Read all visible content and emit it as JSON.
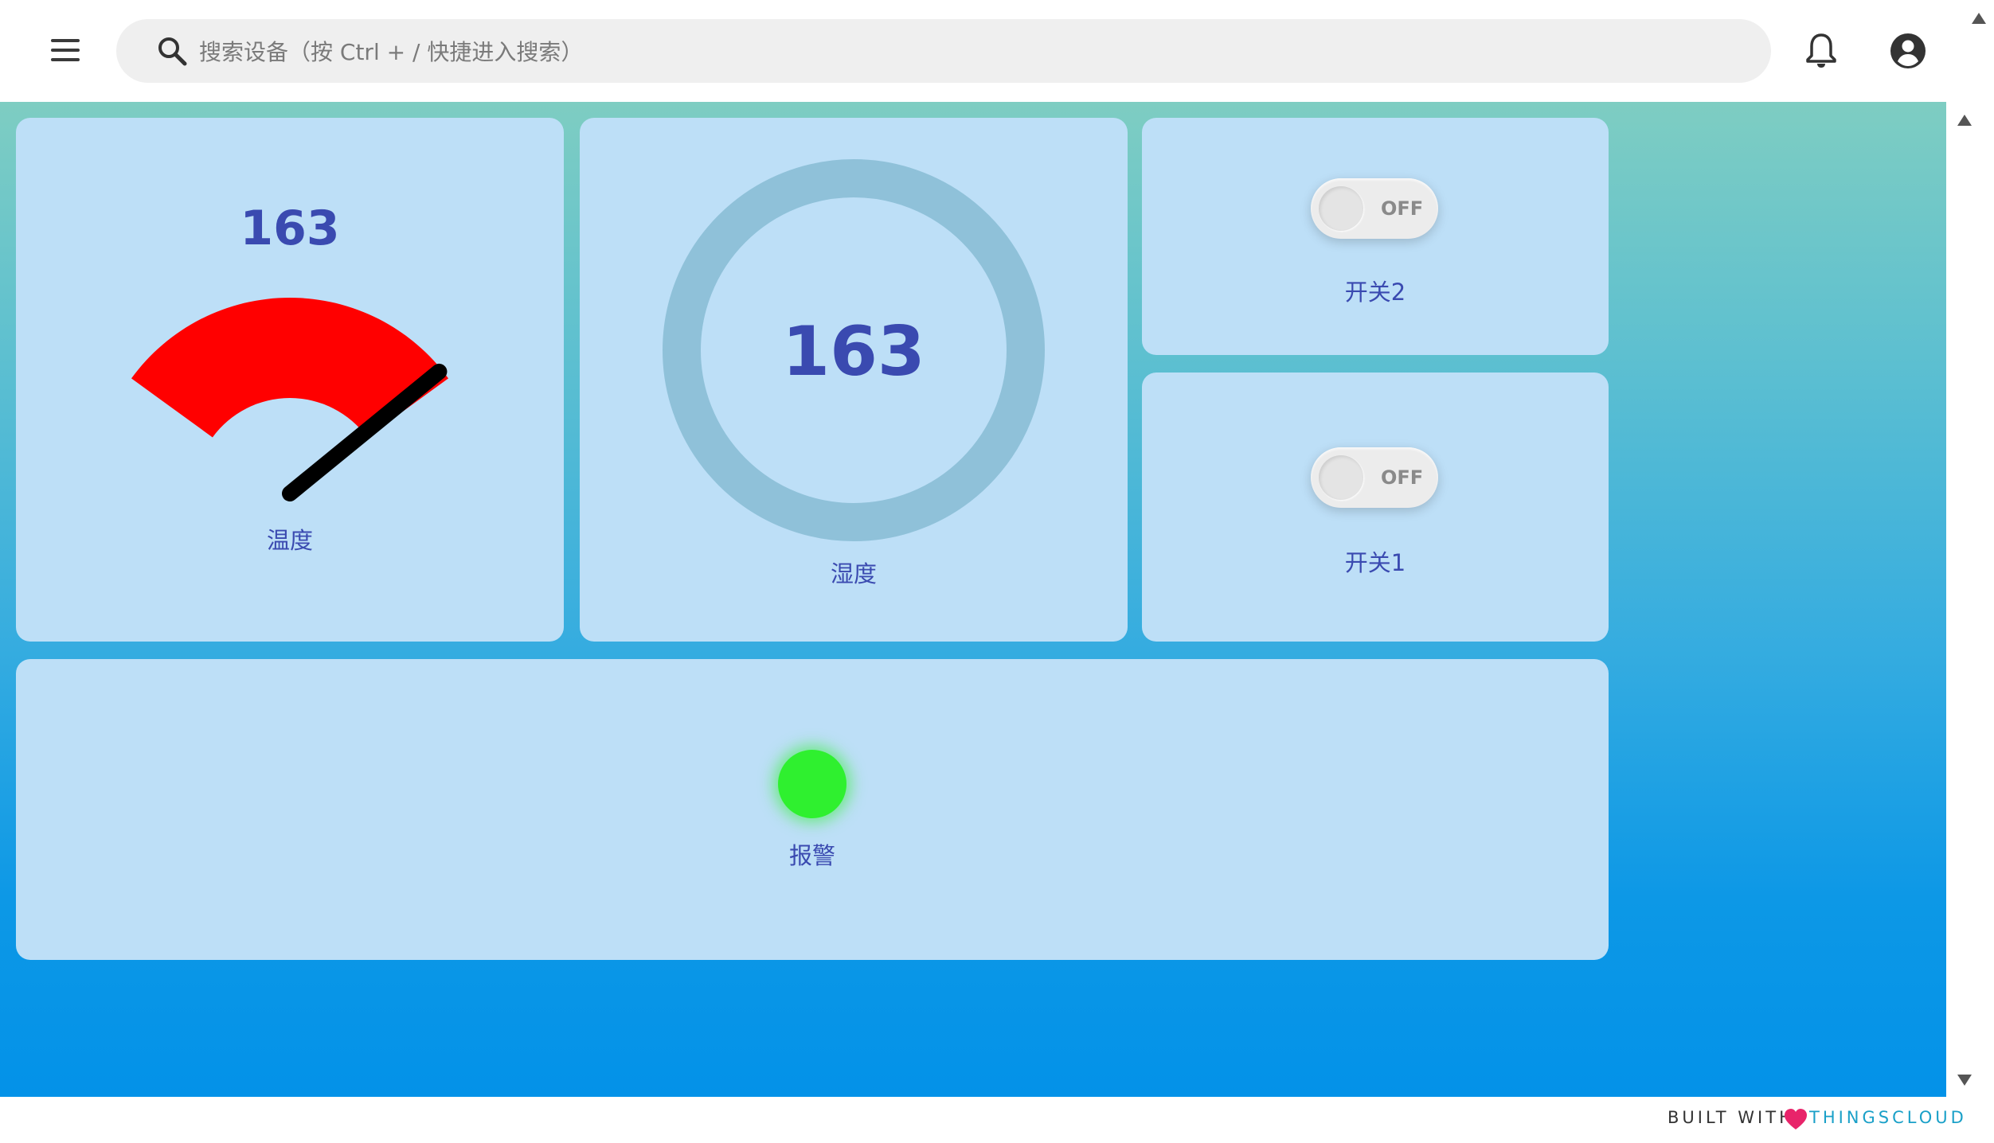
{
  "search": {
    "placeholder": "搜索设备（按 Ctrl + / 快捷进入搜索）"
  },
  "widgets": {
    "temperature": {
      "value": "163",
      "label": "温度",
      "gauge_level": 0.97,
      "color": "#ff0000"
    },
    "humidity": {
      "value": "163",
      "label": "湿度",
      "ring_color": "#8fc1d9"
    },
    "switch2": {
      "state": "OFF",
      "label": "开关2"
    },
    "switch1": {
      "state": "OFF",
      "label": "开关1"
    },
    "alarm": {
      "label": "报警",
      "status_color": "#2ff02f"
    }
  },
  "footer": {
    "built_with": "BUILT WITH",
    "brand": "THINGSCLOUD",
    "heart_color": "#e8246a"
  },
  "icons": [
    "menu-icon",
    "search-icon",
    "bell-icon",
    "account-icon",
    "heart-icon"
  ]
}
